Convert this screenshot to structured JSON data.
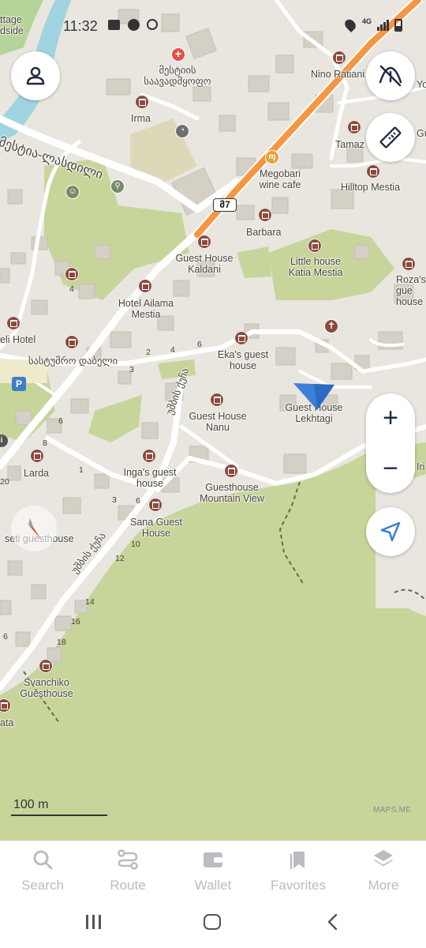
{
  "status_bar": {
    "time": "11:32",
    "network": "4G"
  },
  "map": {
    "scale_label": "100 m",
    "attribution": "MAPS.ME",
    "road_shield": "მ7",
    "street_labels": [
      "-მესტია-ლასდილი",
      "სასტუმრო დაბელი",
      "უშბის ქუჩა",
      "უშბის ქუჩა"
    ],
    "place_labels": {
      "edge_tl_1": "ttage",
      "edge_tl_2": "dside",
      "mestia_school": "მესტიის საავადმყოფო",
      "irma": "Irma",
      "nino": "Nino Ratiani",
      "tamaz": "Tamaz",
      "edge_r1": "Gu",
      "edge_r2": "Yo",
      "megobari": "Megobari wine cafe",
      "hilltop": "Hilltop Mestia",
      "barbara": "Barbara",
      "gh_kaldani": "Guest House Kaldani",
      "little_house": "Little house Katia Mestia",
      "roza": "Roza's gue house",
      "ailama": "Hotel Ailama Mestia",
      "eli": "eli Hotel",
      "eka": "Eka's guest house",
      "gh_nanu": "Guest House Nanu",
      "gh_lekhtagi": "Guest House Lekhtagi",
      "edge_iri": "Iri",
      "larda": "Larda",
      "inga": "Inga's guest house",
      "gh_mountain": "Guesthouse Mountain View",
      "sana": "Sana Guest House",
      "seti": "seti guesthouse",
      "svanchiko": "Svanchiko Guesthouse",
      "edge_ata": "ata"
    },
    "house_numbers": [
      "4",
      "2",
      "4",
      "6",
      "3",
      "6",
      "8",
      "1",
      "20",
      "3",
      "6",
      "10",
      "12",
      "14",
      "16",
      "18",
      "6"
    ]
  },
  "controls": {
    "profile": "profile",
    "traffic_toggle": "traffic off",
    "ruler": "measure distance",
    "zoom_in": "+",
    "zoom_out": "−",
    "my_position": "my position",
    "compass": "compass"
  },
  "bottom_nav": [
    {
      "label": "Search",
      "icon": "search-icon"
    },
    {
      "label": "Route",
      "icon": "route-icon"
    },
    {
      "label": "Wallet",
      "icon": "wallet-icon"
    },
    {
      "label": "Favorites",
      "icon": "bookmark-icon"
    },
    {
      "label": "More",
      "icon": "layers-icon"
    }
  ],
  "colors": {
    "map_background": "#e8e6df",
    "park_green": "#c7d59a",
    "highway_orange": "#f59642",
    "poi_brown": "#8a4b3f",
    "position_blue": "#3d7fd6",
    "nav_inactive": "#b9bcc0",
    "control_icon": "#1f2a44"
  }
}
